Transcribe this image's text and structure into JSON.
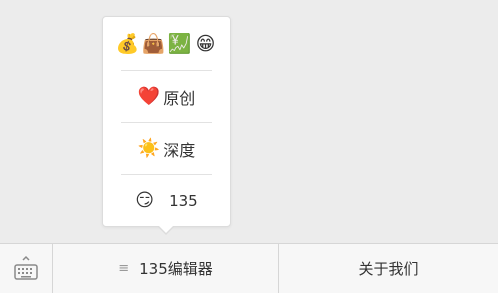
{
  "popup_menu": {
    "emoji_row": [
      "💰",
      "👜",
      "💹",
      "😁"
    ],
    "items": [
      {
        "icon": "❤️",
        "label": "原创"
      },
      {
        "icon": "☀️",
        "label": "深度"
      },
      {
        "icon": "😏",
        "label": "135"
      }
    ]
  },
  "bottom_bar": {
    "keyboard_icon": "keyboard-icon",
    "menu_glyph": "≡",
    "tab1_label": "135编辑器",
    "tab2_label": "关于我们"
  }
}
